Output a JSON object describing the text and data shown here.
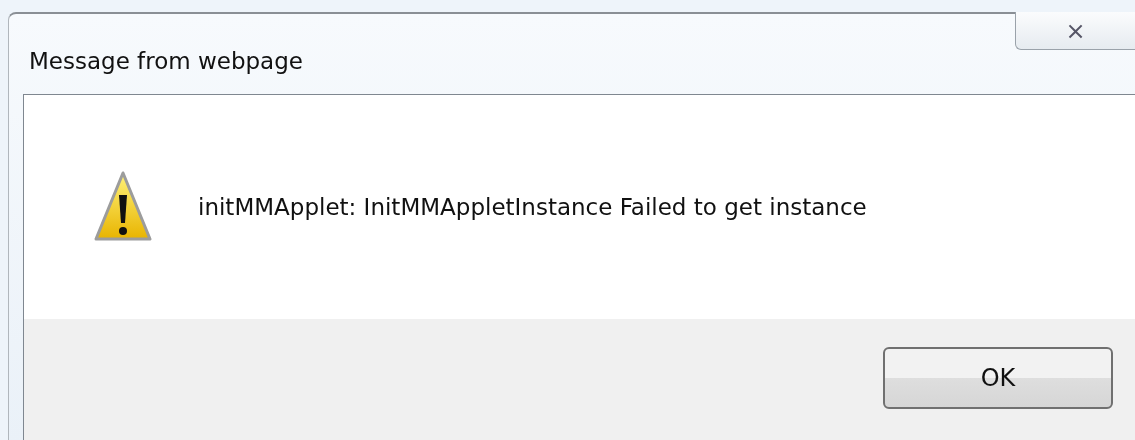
{
  "window": {
    "title": "Message from webpage",
    "close": "⨯"
  },
  "message": "initMMApplet: InitMMAppletInstance Failed to get instance",
  "buttons": [
    {
      "label": "OK"
    }
  ]
}
